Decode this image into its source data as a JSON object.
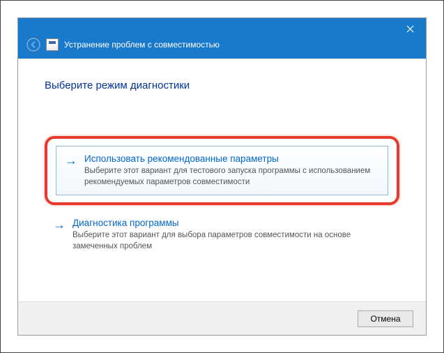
{
  "header": {
    "title": "Устранение проблем с совместимостью"
  },
  "page": {
    "title": "Выберите режим диагностики"
  },
  "options": [
    {
      "title": "Использовать рекомендованные параметры",
      "desc": "Выберите этот вариант для тестового запуска программы с использованием рекомендуемых параметров совместимости"
    },
    {
      "title": "Диагностика программы",
      "desc": "Выберите этот вариант для выбора параметров совместимости на основе замеченных проблем"
    }
  ],
  "footer": {
    "cancel": "Отмена"
  }
}
